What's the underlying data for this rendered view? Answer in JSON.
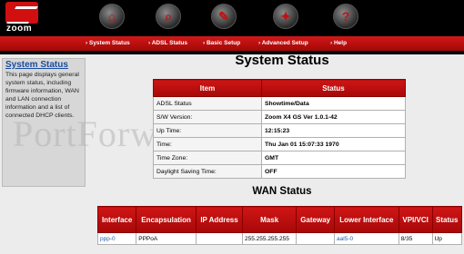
{
  "brand": {
    "name": "zoom",
    "accent": "#c41010"
  },
  "nav": {
    "items": [
      {
        "label": "System Status",
        "icon": "house-icon"
      },
      {
        "label": "ADSL Status",
        "icon": "magnifier-icon"
      },
      {
        "label": "Basic Setup",
        "icon": "tools-icon"
      },
      {
        "label": "Advanced Setup",
        "icon": "wrench-icon"
      },
      {
        "label": "Help",
        "icon": "question-icon"
      }
    ]
  },
  "sidebar": {
    "title": "System Status",
    "description": "This page displays general system status, including firmware information, WAN and LAN connection information and a list of connected DHCP clients."
  },
  "watermark": "PortForward",
  "main": {
    "title": "System Status",
    "status_table": {
      "headers": [
        "Item",
        "Status"
      ],
      "rows": [
        {
          "item": "ADSL Status",
          "status": "Showtime/Data"
        },
        {
          "item": "S/W Version:",
          "status": "Zoom X4 GS Ver 1.0.1-42"
        },
        {
          "item": "Up Time:",
          "status": "12:15:23"
        },
        {
          "item": "Time:",
          "status": "Thu Jan 01 15:07:33 1970"
        },
        {
          "item": "Time Zone:",
          "status": "GMT"
        },
        {
          "item": "Daylight Saving Time:",
          "status": "OFF"
        }
      ]
    },
    "wan_title": "WAN Status",
    "wan_table": {
      "headers": [
        "Interface",
        "Encapsulation",
        "IP Address",
        "Mask",
        "Gateway",
        "Lower Interface",
        "VPI/VCI",
        "Status"
      ],
      "rows": [
        [
          "ppp-0",
          "PPPoA",
          "",
          "255.255.255.255",
          "",
          "aal5-0",
          "8/35",
          "Up"
        ]
      ]
    }
  }
}
